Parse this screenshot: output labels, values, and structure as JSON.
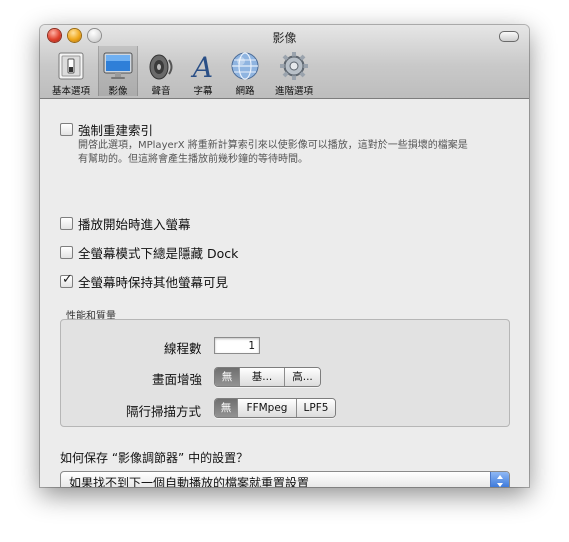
{
  "window": {
    "title": "影像"
  },
  "toolbar": {
    "items": [
      {
        "label": "基本選項",
        "icon": "switch-icon"
      },
      {
        "label": "影像",
        "icon": "monitor-icon"
      },
      {
        "label": "聲音",
        "icon": "speaker-icon"
      },
      {
        "label": "字幕",
        "icon": "font-icon"
      },
      {
        "label": "網路",
        "icon": "globe-icon"
      },
      {
        "label": "進階選項",
        "icon": "gear-icon"
      }
    ],
    "selected": "影像"
  },
  "options": {
    "force_rebuild_index": {
      "label": "強制重建索引",
      "checked": false,
      "desc_line1": "開啓此選項，MPlayerX 將重新計算索引來以使影像可以播放，這對於一些損壞的檔案是",
      "desc_line2": "有幫助的。但這將會產生播放前幾秒鐘的等待時間。"
    },
    "fullscreen_on_start": {
      "label": "播放開始時進入螢幕",
      "checked": false
    },
    "hide_dock": {
      "label": "全螢幕模式下總是隱藏 Dock",
      "checked": false
    },
    "keep_other_screens": {
      "label": "全螢幕時保持其他螢幕可見",
      "checked": true
    }
  },
  "performance": {
    "group_title": "性能和質量",
    "threads_label": "線程數",
    "threads_value": "1",
    "enhance_label": "畫面增強",
    "enhance_options": [
      "無",
      "基...",
      "高..."
    ],
    "enhance_selected": 0,
    "deinterlace_label": "隔行掃描方式",
    "deinterlace_options": [
      "無",
      "FFMpeg",
      "LPF5"
    ],
    "deinterlace_selected": 0
  },
  "save_settings": {
    "question": "如何保存 “影像調節器” 中的設置？",
    "selected_option": "如果找不到下一個自動播放的檔案就重置設置"
  },
  "colors": {
    "accent": "#3b7ad9",
    "close": "#e0432f",
    "minimize": "#f0a81c"
  }
}
